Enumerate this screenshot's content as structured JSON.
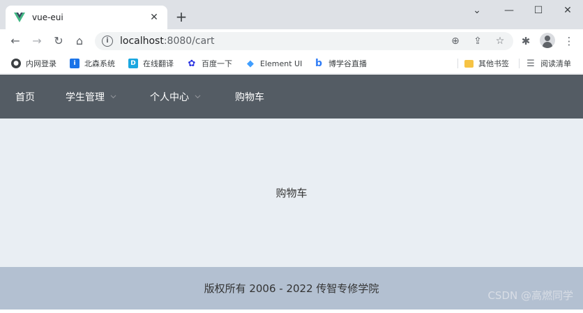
{
  "browser": {
    "tab": {
      "title": "vue-eui",
      "close": "✕"
    },
    "new_tab": "+",
    "window_controls": {
      "minimize": "⌄",
      "restore": "—",
      "maximize": "☐",
      "close": "✕"
    },
    "nav": {
      "back": "←",
      "forward": "→",
      "reload": "↻",
      "home": "⌂"
    },
    "address": {
      "host": "localhost",
      "rest": ":8080/cart"
    },
    "omnibox_actions": {
      "zoom": "⊕",
      "share": "⇪",
      "star": "☆"
    },
    "toolbar": {
      "extensions": "✱",
      "menu": "⋮"
    }
  },
  "bookmarks": [
    {
      "label": "内网登录",
      "color": "#3c4043",
      "glyph": "●"
    },
    {
      "label": "北森系统",
      "color": "#1a73e8",
      "glyph": "i"
    },
    {
      "label": "在线翻译",
      "color": "#1aa7e0",
      "glyph": "D"
    },
    {
      "label": "百度一下",
      "color": "#2932e1",
      "glyph": "✿"
    },
    {
      "label": "Element UI",
      "color": "#409eff",
      "glyph": "◆"
    },
    {
      "label": "博学谷直播",
      "color": "#2f7cf6",
      "glyph": "b"
    }
  ],
  "bookmarks_right": [
    {
      "label": "其他书签",
      "color": "#f6c344",
      "glyph": ""
    },
    {
      "label": "阅读清单",
      "color": "#5f6368",
      "glyph": "☰"
    }
  ],
  "header": {
    "menu": [
      {
        "label": "首页",
        "has_submenu": false
      },
      {
        "label": "学生管理",
        "has_submenu": true
      },
      {
        "label": "个人中心",
        "has_submenu": true
      },
      {
        "label": "购物车",
        "has_submenu": false
      }
    ],
    "bg_color": "#545c64"
  },
  "main": {
    "text": "购物车",
    "bg_color": "#e9eef3"
  },
  "footer": {
    "text": "版权所有 2006 - 2022 传智专修学院",
    "bg_color": "#b3c0d1"
  },
  "watermark": "CSDN @高燃同学"
}
